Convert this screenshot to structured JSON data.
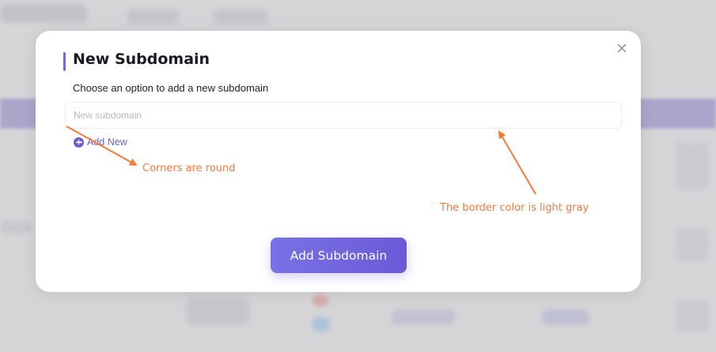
{
  "modal": {
    "title": "New Subdomain",
    "subtitle": "Choose an option to add a new subdomain",
    "input_placeholder": "New subdomain",
    "input_value": "",
    "add_new_label": "Add New",
    "submit_label": "Add Subdomain",
    "close_icon": "close-icon",
    "add_icon": "plus-circle-icon"
  },
  "annotations": {
    "corners_note": "Corners are round",
    "border_note": "The border color is light gray"
  },
  "colors": {
    "accent": "#6c5ccf",
    "annotation": "#f27a3a",
    "input_border": "#ececf0"
  }
}
